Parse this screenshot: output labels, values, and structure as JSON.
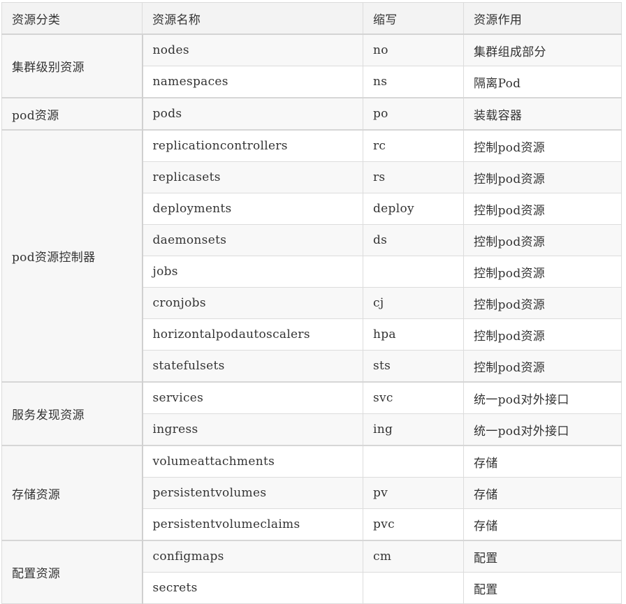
{
  "headers": [
    "资源分类",
    "资源名称",
    "缩写",
    "资源作用"
  ],
  "groups": [
    {
      "category": "集群级别资源",
      "rows": [
        {
          "name": "nodes",
          "abbr": "no",
          "purpose": "集群组成部分"
        },
        {
          "name": "namespaces",
          "abbr": "ns",
          "purpose": "隔离Pod"
        }
      ]
    },
    {
      "category": "pod资源",
      "rows": [
        {
          "name": "pods",
          "abbr": "po",
          "purpose": "装载容器"
        }
      ]
    },
    {
      "category": "pod资源控制器",
      "rows": [
        {
          "name": "replicationcontrollers",
          "abbr": "rc",
          "purpose": "控制pod资源"
        },
        {
          "name": "replicasets",
          "abbr": "rs",
          "purpose": "控制pod资源"
        },
        {
          "name": "deployments",
          "abbr": "deploy",
          "purpose": "控制pod资源"
        },
        {
          "name": "daemonsets",
          "abbr": "ds",
          "purpose": "控制pod资源"
        },
        {
          "name": "jobs",
          "abbr": "",
          "purpose": "控制pod资源"
        },
        {
          "name": "cronjobs",
          "abbr": "cj",
          "purpose": "控制pod资源"
        },
        {
          "name": "horizontalpodautoscalers",
          "abbr": "hpa",
          "purpose": "控制pod资源"
        },
        {
          "name": "statefulsets",
          "abbr": "sts",
          "purpose": "控制pod资源"
        }
      ]
    },
    {
      "category": "服务发现资源",
      "rows": [
        {
          "name": "services",
          "abbr": "svc",
          "purpose": "统一pod对外接口"
        },
        {
          "name": "ingress",
          "abbr": "ing",
          "purpose": "统一pod对外接口"
        }
      ]
    },
    {
      "category": "存储资源",
      "rows": [
        {
          "name": "volumeattachments",
          "abbr": "",
          "purpose": "存储"
        },
        {
          "name": "persistentvolumes",
          "abbr": "pv",
          "purpose": "存储"
        },
        {
          "name": "persistentvolumeclaims",
          "abbr": "pvc",
          "purpose": "存储"
        }
      ]
    },
    {
      "category": "配置资源",
      "rows": [
        {
          "name": "configmaps",
          "abbr": "cm",
          "purpose": "配置"
        },
        {
          "name": "secrets",
          "abbr": "",
          "purpose": "配置"
        }
      ]
    }
  ]
}
